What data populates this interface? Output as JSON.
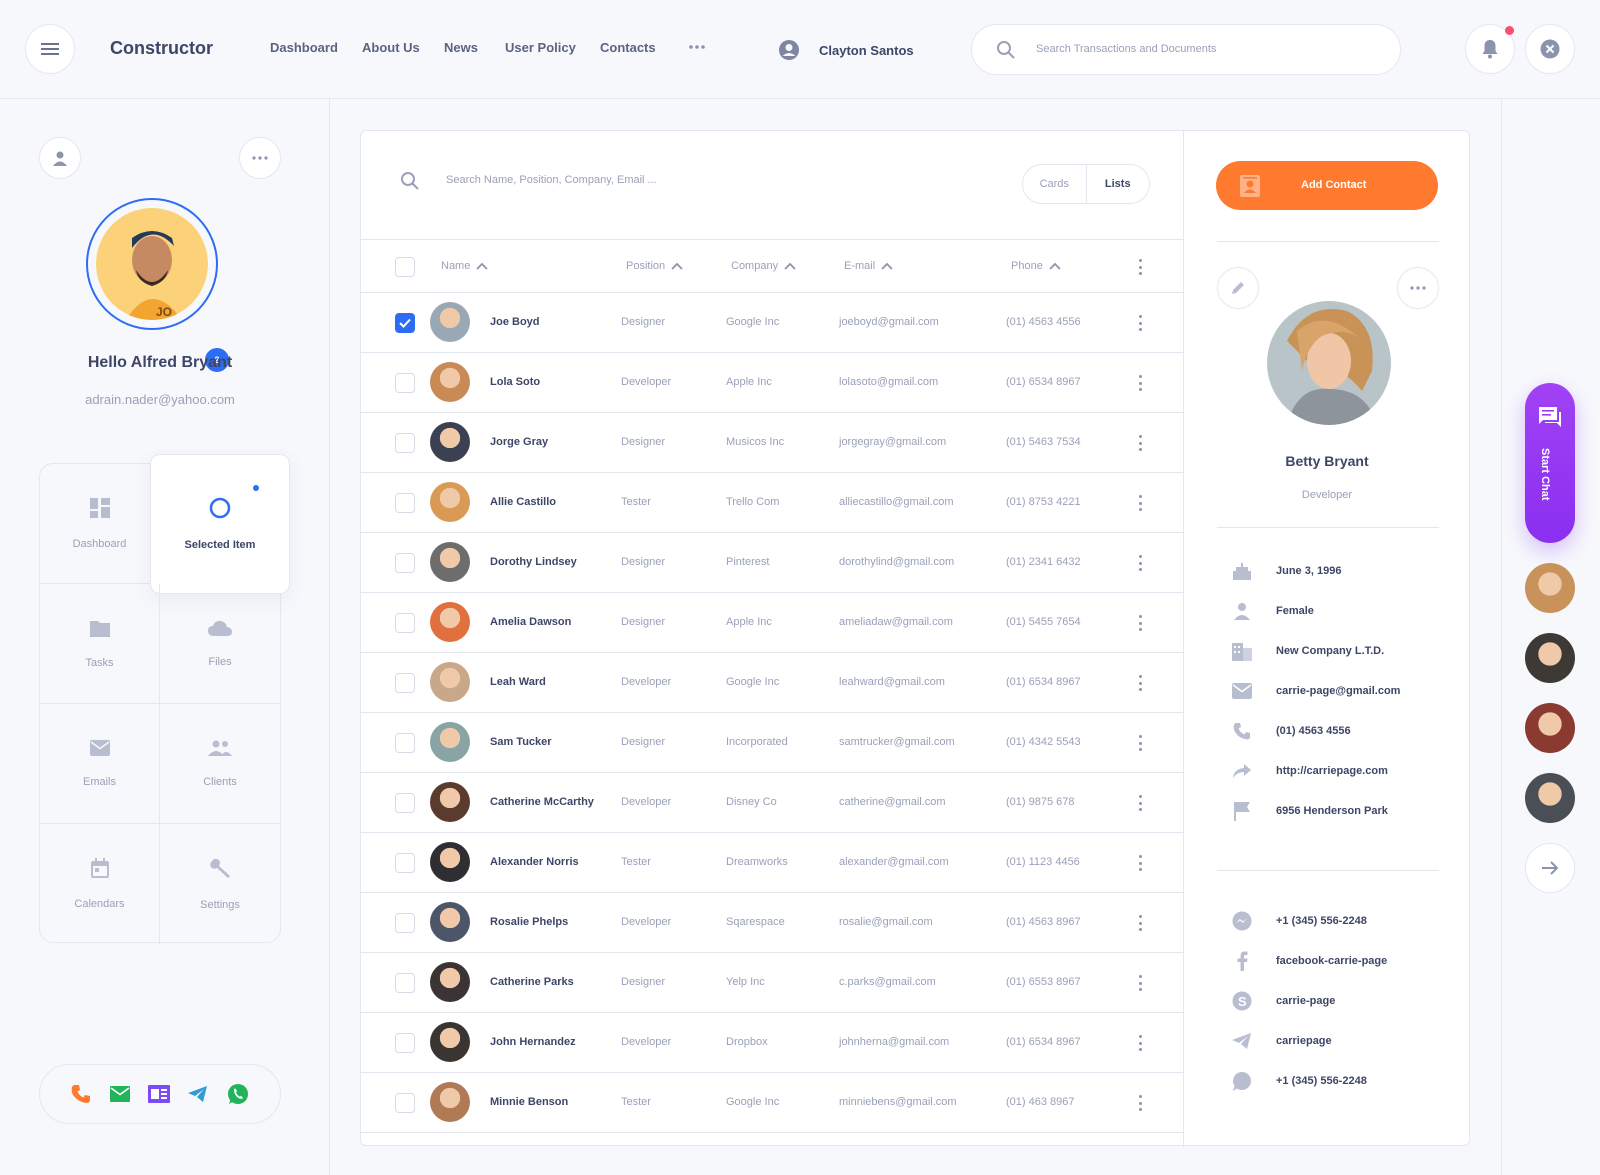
{
  "header": {
    "brand": "Constructor",
    "nav": [
      "Dashboard",
      "About Us",
      "News",
      "User Policy",
      "Contacts"
    ],
    "user_name": "Clayton Santos",
    "search_placeholder": "Search Transactions and Documents"
  },
  "sidebar": {
    "badge_count": "2",
    "greeting": "Hello Alfred Bryant",
    "email": "adrain.nader@yahoo.com",
    "menu": [
      {
        "label": "Dashboard",
        "icon": "dashboard-icon"
      },
      {
        "label": "Selected Item",
        "icon": "circle-icon"
      },
      {
        "label": "Tasks",
        "icon": "folder-icon"
      },
      {
        "label": "Files",
        "icon": "cloud-icon"
      },
      {
        "label": "Emails",
        "icon": "mail-icon"
      },
      {
        "label": "Clients",
        "icon": "people-icon"
      },
      {
        "label": "Calendars",
        "icon": "calendar-icon"
      },
      {
        "label": "Settings",
        "icon": "wrench-icon"
      }
    ]
  },
  "table": {
    "search_placeholder": "Search Name, Position, Company, Email ...",
    "view_toggle": [
      "Cards",
      "Lists"
    ],
    "columns": [
      "Name",
      "Position",
      "Company",
      "E-mail",
      "Phone"
    ],
    "rows": [
      {
        "name": "Joe Boyd",
        "position": "Designer",
        "company": "Google Inc",
        "email": "joeboyd@gmail.com",
        "phone": "(01) 4563 4556",
        "checked": true,
        "color": "#9aa8b6"
      },
      {
        "name": "Lola Soto",
        "position": "Developer",
        "company": "Apple Inc",
        "email": "lolasoto@gmail.com",
        "phone": "(01) 6534 8967",
        "checked": false,
        "color": "#c98a55"
      },
      {
        "name": "Jorge Gray",
        "position": "Designer",
        "company": "Musicos Inc",
        "email": "jorgegray@gmail.com",
        "phone": "(01) 5463 7534",
        "checked": false,
        "color": "#3b4052"
      },
      {
        "name": "Allie Castillo",
        "position": "Tester",
        "company": "Trello Com",
        "email": "alliecastillo@gmail.com",
        "phone": "(01) 8753 4221",
        "checked": false,
        "color": "#d99a55"
      },
      {
        "name": "Dorothy Lindsey",
        "position": "Designer",
        "company": "Pinterest",
        "email": "dorothylind@gmail.com",
        "phone": "(01) 2341 6432",
        "checked": false,
        "color": "#6d6d6d"
      },
      {
        "name": "Amelia Dawson",
        "position": "Designer",
        "company": "Apple Inc",
        "email": "ameliadaw@gmail.com",
        "phone": "(01) 5455 7654",
        "checked": false,
        "color": "#e0703e"
      },
      {
        "name": "Leah Ward",
        "position": "Developer",
        "company": "Google Inc",
        "email": "leahward@gmail.com",
        "phone": "(01) 6534 8967",
        "checked": false,
        "color": "#c9a88a"
      },
      {
        "name": "Sam Tucker",
        "position": "Designer",
        "company": "Incorporated",
        "email": "samtrucker@gmail.com",
        "phone": "(01) 4342 5543",
        "checked": false,
        "color": "#8aa3a5"
      },
      {
        "name": "Catherine McCarthy",
        "position": "Developer",
        "company": "Disney Co",
        "email": "catherine@gmail.com",
        "phone": "(01) 9875 678",
        "checked": false,
        "color": "#5a3b2e"
      },
      {
        "name": "Alexander Norris",
        "position": "Tester",
        "company": "Dreamworks",
        "email": "alexander@gmail.com",
        "phone": "(01) 1123 4456",
        "checked": false,
        "color": "#2e2e33"
      },
      {
        "name": "Rosalie Phelps",
        "position": "Developer",
        "company": "Sqarespace",
        "email": "rosalie@gmail.com",
        "phone": "(01) 4563 8967",
        "checked": false,
        "color": "#4d5568"
      },
      {
        "name": "Catherine Parks",
        "position": "Designer",
        "company": "Yelp Inc",
        "email": "c.parks@gmail.com",
        "phone": "(01) 6553 8967",
        "checked": false,
        "color": "#3c3434"
      },
      {
        "name": "John Hernandez",
        "position": "Developer",
        "company": "Dropbox",
        "email": "johnherna@gmail.com",
        "phone": "(01) 6534 8967",
        "checked": false,
        "color": "#3a3530"
      },
      {
        "name": "Minnie Benson",
        "position": "Tester",
        "company": "Google Inc",
        "email": "minniebens@gmail.com",
        "phone": "(01) 463 8967",
        "checked": false,
        "color": "#b07a55"
      }
    ]
  },
  "detail": {
    "add_button": "Add Contact",
    "name": "Betty Bryant",
    "role": "Developer",
    "info": [
      {
        "icon": "cake-icon",
        "text": "June 3, 1996"
      },
      {
        "icon": "person-icon",
        "text": "Female"
      },
      {
        "icon": "building-icon",
        "text": "New Company  L.T.D."
      },
      {
        "icon": "mail-icon",
        "text": "carrie-page@gmail.com"
      },
      {
        "icon": "phone-icon",
        "text": "(01) 4563 4556"
      },
      {
        "icon": "share-icon",
        "text": "http://carriepage.com"
      },
      {
        "icon": "flag-icon",
        "text": "6956 Henderson Park"
      }
    ],
    "social": [
      {
        "icon": "messenger-icon",
        "text": "+1 (345) 556-2248"
      },
      {
        "icon": "facebook-icon",
        "text": "facebook-carrie-page"
      },
      {
        "icon": "skype-icon",
        "text": "carrie-page"
      },
      {
        "icon": "telegram-icon",
        "text": "carriepage"
      },
      {
        "icon": "whatsapp-icon",
        "text": "+1 (345) 556-2248"
      }
    ]
  },
  "rail": {
    "chat_label": "Start Chat",
    "avatars": [
      "#c9925a",
      "#3d3a35",
      "#8a3a30",
      "#4a4f55"
    ]
  },
  "colors": {
    "accent_orange": "#ff7a2f",
    "accent_purple": "#9b3cf5",
    "accent_blue": "#2d6cf5",
    "notification_dot": "#ff4d6d"
  }
}
